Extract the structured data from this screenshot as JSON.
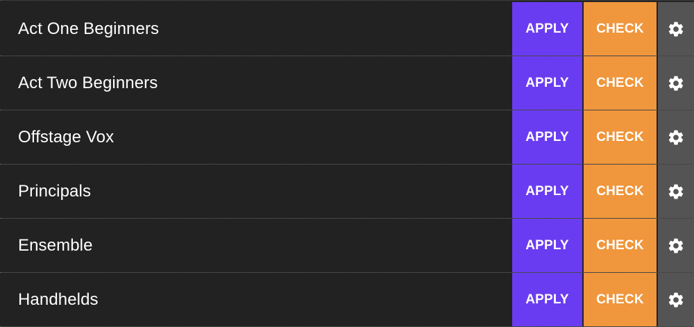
{
  "theme": {
    "background": "#232323",
    "row_background": "#222222",
    "apply_color": "#6a3cf1",
    "check_color": "#f0963c",
    "settings_color": "#545454",
    "text_color": "#ffffff"
  },
  "rows": [
    {
      "name": "Act One Beginners",
      "apply_label": "APPLY",
      "check_label": "CHECK",
      "settings_icon": "gear-icon"
    },
    {
      "name": "Act Two Beginners",
      "apply_label": "APPLY",
      "check_label": "CHECK",
      "settings_icon": "gear-icon"
    },
    {
      "name": "Offstage Vox",
      "apply_label": "APPLY",
      "check_label": "CHECK",
      "settings_icon": "gear-icon"
    },
    {
      "name": "Principals",
      "apply_label": "APPLY",
      "check_label": "CHECK",
      "settings_icon": "gear-icon"
    },
    {
      "name": "Ensemble",
      "apply_label": "APPLY",
      "check_label": "CHECK",
      "settings_icon": "gear-icon"
    },
    {
      "name": "Handhelds",
      "apply_label": "APPLY",
      "check_label": "CHECK",
      "settings_icon": "gear-icon"
    }
  ]
}
